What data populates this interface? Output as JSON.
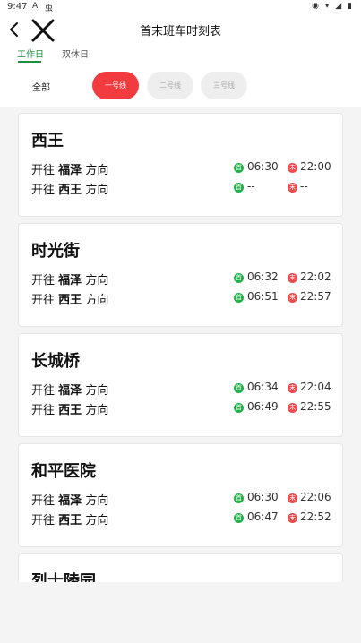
{
  "status_bar": {
    "time": "9:47",
    "indicator_a": "A",
    "indicator_b": "虫",
    "right_icons": "◉ ▾ ◢ ▮"
  },
  "header": {
    "title": "首末班车时刻表",
    "tabs": [
      {
        "label": "工作日",
        "active": true
      },
      {
        "label": "双休日",
        "active": false
      }
    ]
  },
  "filters": {
    "all_label": "全部",
    "lines": [
      {
        "label": "一号线",
        "active": true
      },
      {
        "label": "二号线",
        "active": false
      },
      {
        "label": "三号线",
        "active": false
      }
    ]
  },
  "labels": {
    "prefix": "开往",
    "suffix": "方向",
    "first_badge": "首",
    "last_badge": "末"
  },
  "colors": {
    "accent_green": "#1b8f3f",
    "active_pill_red": "#f23b3f",
    "first_badge_green": "#22b04a",
    "last_badge_red": "#f0484b"
  },
  "stations": [
    {
      "name": "西王",
      "rows": [
        {
          "dest": "福泽",
          "first": "06:30",
          "last": "22:00"
        },
        {
          "dest": "西王",
          "first": "--",
          "last": "--"
        }
      ]
    },
    {
      "name": "时光街",
      "rows": [
        {
          "dest": "福泽",
          "first": "06:32",
          "last": "22:02"
        },
        {
          "dest": "西王",
          "first": "06:51",
          "last": "22:57"
        }
      ]
    },
    {
      "name": "长城桥",
      "rows": [
        {
          "dest": "福泽",
          "first": "06:34",
          "last": "22:04"
        },
        {
          "dest": "西王",
          "first": "06:49",
          "last": "22:55"
        }
      ]
    },
    {
      "name": "和平医院",
      "rows": [
        {
          "dest": "福泽",
          "first": "06:30",
          "last": "22:06"
        },
        {
          "dest": "西王",
          "first": "06:47",
          "last": "22:52"
        }
      ]
    },
    {
      "name": "烈士陵园",
      "rows": []
    }
  ]
}
